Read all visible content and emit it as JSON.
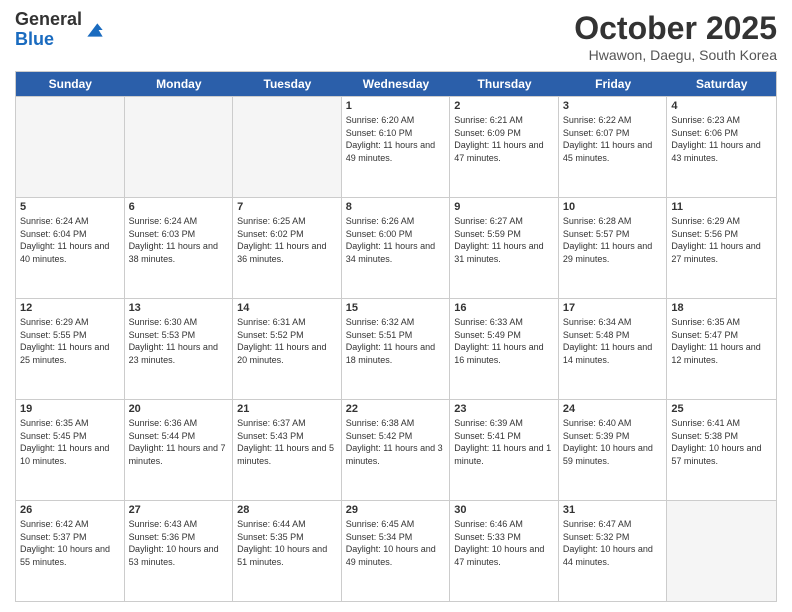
{
  "header": {
    "logo_general": "General",
    "logo_blue": "Blue",
    "month": "October 2025",
    "location": "Hwawon, Daegu, South Korea"
  },
  "days_of_week": [
    "Sunday",
    "Monday",
    "Tuesday",
    "Wednesday",
    "Thursday",
    "Friday",
    "Saturday"
  ],
  "rows": [
    [
      {
        "day": "",
        "info": ""
      },
      {
        "day": "",
        "info": ""
      },
      {
        "day": "",
        "info": ""
      },
      {
        "day": "1",
        "info": "Sunrise: 6:20 AM\nSunset: 6:10 PM\nDaylight: 11 hours and 49 minutes."
      },
      {
        "day": "2",
        "info": "Sunrise: 6:21 AM\nSunset: 6:09 PM\nDaylight: 11 hours and 47 minutes."
      },
      {
        "day": "3",
        "info": "Sunrise: 6:22 AM\nSunset: 6:07 PM\nDaylight: 11 hours and 45 minutes."
      },
      {
        "day": "4",
        "info": "Sunrise: 6:23 AM\nSunset: 6:06 PM\nDaylight: 11 hours and 43 minutes."
      }
    ],
    [
      {
        "day": "5",
        "info": "Sunrise: 6:24 AM\nSunset: 6:04 PM\nDaylight: 11 hours and 40 minutes."
      },
      {
        "day": "6",
        "info": "Sunrise: 6:24 AM\nSunset: 6:03 PM\nDaylight: 11 hours and 38 minutes."
      },
      {
        "day": "7",
        "info": "Sunrise: 6:25 AM\nSunset: 6:02 PM\nDaylight: 11 hours and 36 minutes."
      },
      {
        "day": "8",
        "info": "Sunrise: 6:26 AM\nSunset: 6:00 PM\nDaylight: 11 hours and 34 minutes."
      },
      {
        "day": "9",
        "info": "Sunrise: 6:27 AM\nSunset: 5:59 PM\nDaylight: 11 hours and 31 minutes."
      },
      {
        "day": "10",
        "info": "Sunrise: 6:28 AM\nSunset: 5:57 PM\nDaylight: 11 hours and 29 minutes."
      },
      {
        "day": "11",
        "info": "Sunrise: 6:29 AM\nSunset: 5:56 PM\nDaylight: 11 hours and 27 minutes."
      }
    ],
    [
      {
        "day": "12",
        "info": "Sunrise: 6:29 AM\nSunset: 5:55 PM\nDaylight: 11 hours and 25 minutes."
      },
      {
        "day": "13",
        "info": "Sunrise: 6:30 AM\nSunset: 5:53 PM\nDaylight: 11 hours and 23 minutes."
      },
      {
        "day": "14",
        "info": "Sunrise: 6:31 AM\nSunset: 5:52 PM\nDaylight: 11 hours and 20 minutes."
      },
      {
        "day": "15",
        "info": "Sunrise: 6:32 AM\nSunset: 5:51 PM\nDaylight: 11 hours and 18 minutes."
      },
      {
        "day": "16",
        "info": "Sunrise: 6:33 AM\nSunset: 5:49 PM\nDaylight: 11 hours and 16 minutes."
      },
      {
        "day": "17",
        "info": "Sunrise: 6:34 AM\nSunset: 5:48 PM\nDaylight: 11 hours and 14 minutes."
      },
      {
        "day": "18",
        "info": "Sunrise: 6:35 AM\nSunset: 5:47 PM\nDaylight: 11 hours and 12 minutes."
      }
    ],
    [
      {
        "day": "19",
        "info": "Sunrise: 6:35 AM\nSunset: 5:45 PM\nDaylight: 11 hours and 10 minutes."
      },
      {
        "day": "20",
        "info": "Sunrise: 6:36 AM\nSunset: 5:44 PM\nDaylight: 11 hours and 7 minutes."
      },
      {
        "day": "21",
        "info": "Sunrise: 6:37 AM\nSunset: 5:43 PM\nDaylight: 11 hours and 5 minutes."
      },
      {
        "day": "22",
        "info": "Sunrise: 6:38 AM\nSunset: 5:42 PM\nDaylight: 11 hours and 3 minutes."
      },
      {
        "day": "23",
        "info": "Sunrise: 6:39 AM\nSunset: 5:41 PM\nDaylight: 11 hours and 1 minute."
      },
      {
        "day": "24",
        "info": "Sunrise: 6:40 AM\nSunset: 5:39 PM\nDaylight: 10 hours and 59 minutes."
      },
      {
        "day": "25",
        "info": "Sunrise: 6:41 AM\nSunset: 5:38 PM\nDaylight: 10 hours and 57 minutes."
      }
    ],
    [
      {
        "day": "26",
        "info": "Sunrise: 6:42 AM\nSunset: 5:37 PM\nDaylight: 10 hours and 55 minutes."
      },
      {
        "day": "27",
        "info": "Sunrise: 6:43 AM\nSunset: 5:36 PM\nDaylight: 10 hours and 53 minutes."
      },
      {
        "day": "28",
        "info": "Sunrise: 6:44 AM\nSunset: 5:35 PM\nDaylight: 10 hours and 51 minutes."
      },
      {
        "day": "29",
        "info": "Sunrise: 6:45 AM\nSunset: 5:34 PM\nDaylight: 10 hours and 49 minutes."
      },
      {
        "day": "30",
        "info": "Sunrise: 6:46 AM\nSunset: 5:33 PM\nDaylight: 10 hours and 47 minutes."
      },
      {
        "day": "31",
        "info": "Sunrise: 6:47 AM\nSunset: 5:32 PM\nDaylight: 10 hours and 44 minutes."
      },
      {
        "day": "",
        "info": ""
      }
    ]
  ]
}
